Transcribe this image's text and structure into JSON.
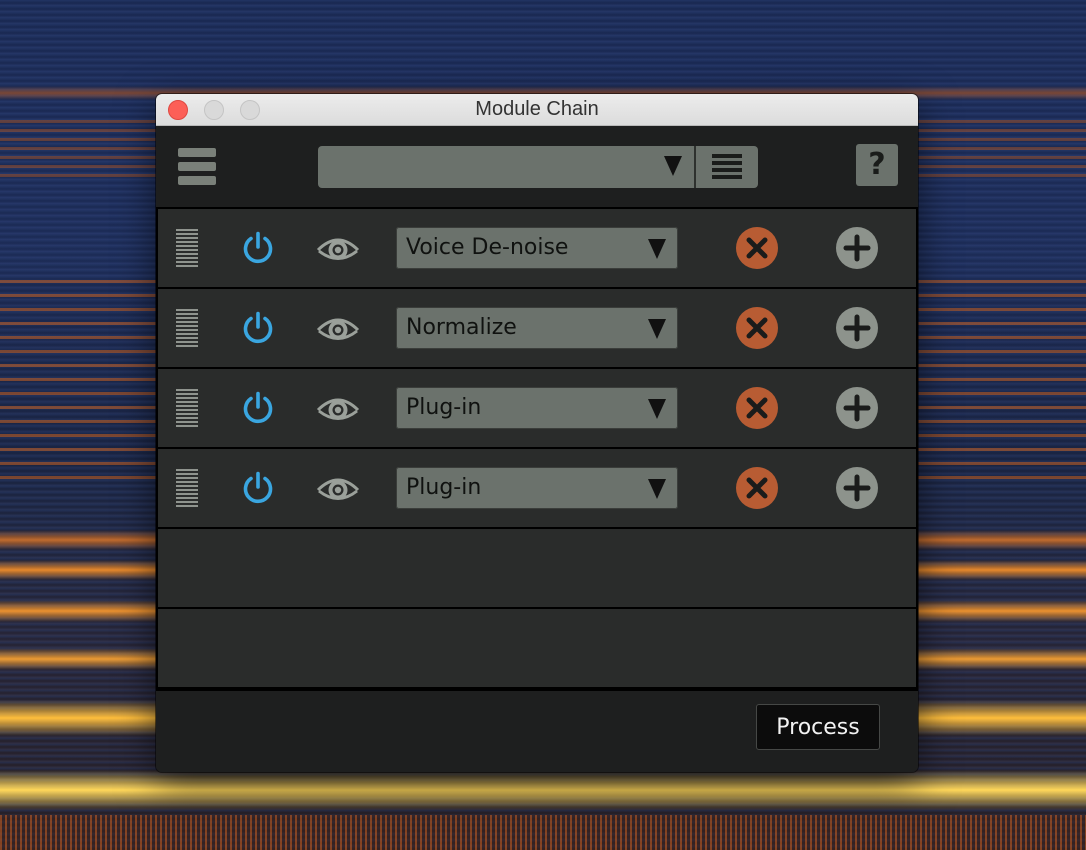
{
  "window": {
    "title": "Module Chain"
  },
  "toolbar": {
    "preset_value": "",
    "help_label": "?"
  },
  "modules": [
    {
      "name": "Voice De-noise"
    },
    {
      "name": "Normalize"
    },
    {
      "name": "Plug-in"
    },
    {
      "name": "Plug-in"
    }
  ],
  "footer": {
    "process_label": "Process"
  },
  "colors": {
    "power_icon": "#3aa6e0",
    "remove_button": "#b85c33",
    "add_button": "#8d938c",
    "dropdown_bg": "#6b726c"
  }
}
